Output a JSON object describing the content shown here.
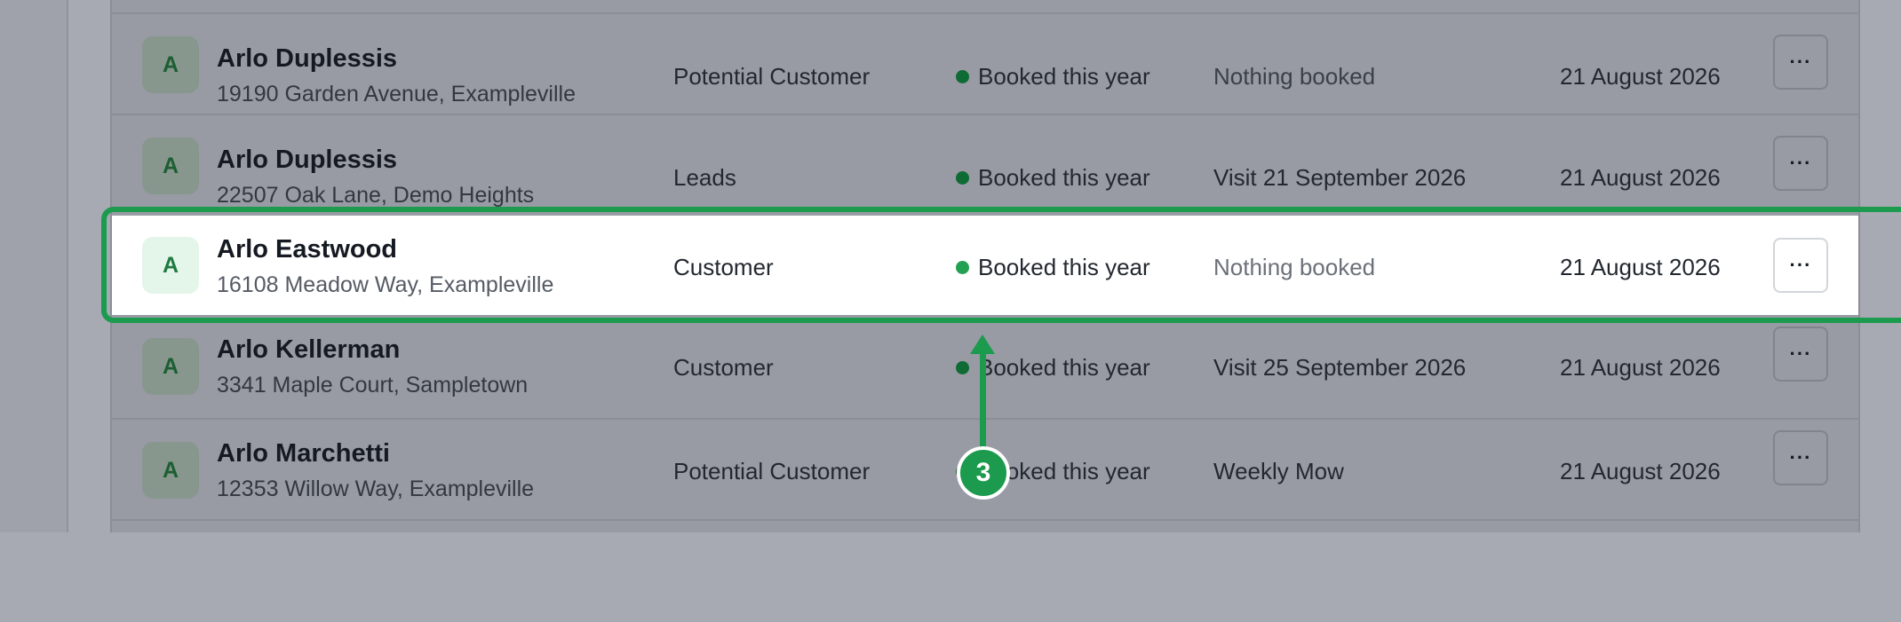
{
  "rows": [
    {
      "initial": "A",
      "name": "Arlo Duplessis",
      "address": "19190 Garden Avenue, Exampleville",
      "category": "Potential Customer",
      "status": "Booked this year",
      "booking": "Nothing booked",
      "date": "21 August 2026",
      "more_label": "···"
    },
    {
      "initial": "A",
      "name": "Arlo Duplessis",
      "address": "22507 Oak Lane, Demo Heights",
      "category": "Leads",
      "status": "Booked this year",
      "booking": "Visit 21 September 2026",
      "date": "21 August 2026",
      "more_label": "···"
    },
    {
      "initial": "A",
      "name": "Arlo Eastwood",
      "address": "16108 Meadow Way, Exampleville",
      "category": "Customer",
      "status": "Booked this year",
      "booking": "Nothing booked",
      "date": "21 August 2026",
      "more_label": "···"
    },
    {
      "initial": "A",
      "name": "Arlo Kellerman",
      "address": "3341 Maple Court, Sampletown",
      "category": "Customer",
      "status": "Booked this year",
      "booking": "Visit 25 September 2026",
      "date": "21 August 2026",
      "more_label": "···"
    },
    {
      "initial": "A",
      "name": "Arlo Marchetti",
      "address": "12353 Willow Way, Exampleville",
      "category": "Potential Customer",
      "status": "Booked this year",
      "booking": "Weekly Mow",
      "date": "21 August 2026",
      "more_label": "···"
    }
  ],
  "annotation": {
    "step": "3"
  },
  "colors": {
    "accent": "#1c9a4d",
    "status_dot": "#22a152",
    "overlay": "#989ba4"
  }
}
